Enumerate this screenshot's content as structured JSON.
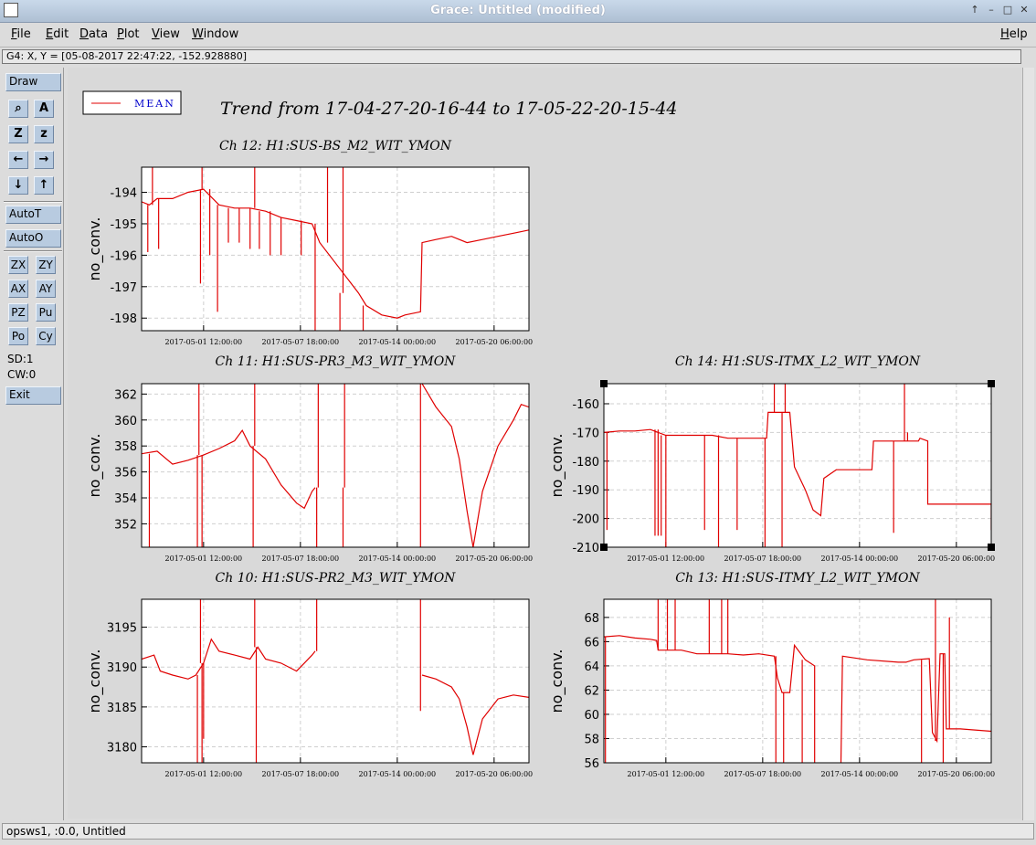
{
  "window": {
    "title": "Grace: Untitled (modified)",
    "buttons": [
      "↑",
      "–",
      "□",
      "✕"
    ]
  },
  "menubar": {
    "items": [
      "File",
      "Edit",
      "Data",
      "Plot",
      "View",
      "Window"
    ],
    "help": "Help"
  },
  "locator": {
    "text": "G4: X, Y = [05-08-2017 22:47:22, -152.928880]"
  },
  "toolpanel": {
    "draw": "Draw",
    "icons": [
      "magnifier-icon",
      "text-icon",
      "zoom-z-big-icon",
      "zoom-z-small-icon",
      "arrow-left-icon",
      "arrow-right-icon",
      "arrow-down-icon",
      "arrow-up-icon"
    ],
    "icon_glyphs": [
      "⌕",
      "A",
      "Z",
      "z",
      "←",
      "→",
      "↓",
      "↑"
    ],
    "autot": "AutoT",
    "autoo": "AutoO",
    "small_buttons": [
      "ZX",
      "ZY",
      "AX",
      "AY",
      "PZ",
      "Pu",
      "Po",
      "Cy"
    ],
    "sd": "SD:1",
    "cw": "CW:0",
    "exit": "Exit"
  },
  "status": {
    "text": "opsws1, :0.0, Untitled"
  },
  "legend": {
    "label": "MEAN",
    "color": "#0000cc",
    "line_color": "#e00000"
  },
  "main_title": "Trend from 17-04-27-20-16-44 to 17-05-22-20-15-44",
  "series_color": "#e00000",
  "chart_data": [
    {
      "type": "line",
      "title": "Ch 12: H1:SUS-BS_M2_WIT_YMON",
      "ylabel": "no_conv.",
      "x_ticks": [
        "2017-05-01 12:00:00",
        "2017-05-07 18:00:00",
        "2017-05-14 00:00:00",
        "2017-05-20 06:00:00"
      ],
      "y_ticks": [
        -194,
        -195,
        -196,
        -197,
        -198
      ],
      "ylim": [
        -198.4,
        -193.2
      ],
      "xlim": [
        0,
        25
      ],
      "trend": [
        [
          0,
          -194.3
        ],
        [
          0.5,
          -194.4
        ],
        [
          1,
          -194.2
        ],
        [
          2,
          -194.2
        ],
        [
          3,
          -194.0
        ],
        [
          4,
          -193.9
        ],
        [
          5,
          -194.4
        ],
        [
          6,
          -194.5
        ],
        [
          7,
          -194.5
        ],
        [
          8,
          -194.6
        ],
        [
          9,
          -194.8
        ],
        [
          10,
          -194.9
        ],
        [
          11,
          -195.0
        ],
        [
          11.5,
          -195.6
        ],
        [
          14,
          -197.2
        ],
        [
          14.5,
          -197.6
        ],
        [
          15.5,
          -197.9
        ],
        [
          16.5,
          -198.0
        ],
        [
          17,
          -197.9
        ],
        [
          18,
          -197.8
        ],
        [
          18.1,
          -195.6
        ],
        [
          19,
          -195.5
        ],
        [
          20,
          -195.4
        ],
        [
          21,
          -195.6
        ],
        [
          22,
          -195.5
        ],
        [
          23,
          -195.4
        ],
        [
          24,
          -195.3
        ],
        [
          25,
          -195.2
        ]
      ],
      "spikes": [
        [
          0.4,
          -195.9
        ],
        [
          0.7,
          -193.1
        ],
        [
          1.1,
          -195.8
        ],
        [
          3.8,
          -196.9
        ],
        [
          3.9,
          -193.1
        ],
        [
          4.4,
          -196.0
        ],
        [
          4.9,
          -197.8
        ],
        [
          5.6,
          -195.6
        ],
        [
          6.3,
          -195.6
        ],
        [
          7.0,
          -195.8
        ],
        [
          7.3,
          -193.1
        ],
        [
          7.6,
          -195.8
        ],
        [
          8.3,
          -196.0
        ],
        [
          9.0,
          -196.0
        ],
        [
          10.3,
          -196.0
        ],
        [
          11.2,
          -198.4
        ],
        [
          12.0,
          -193.1
        ],
        [
          12.8,
          -198.4
        ],
        [
          13.0,
          -193.1
        ],
        [
          14.3,
          -198.4
        ]
      ]
    },
    {
      "type": "line",
      "title": "Ch 11: H1:SUS-PR3_M3_WIT_YMON",
      "ylabel": "no_conv.",
      "x_ticks": [
        "2017-05-01 12:00:00",
        "2017-05-07 18:00:00",
        "2017-05-14 00:00:00",
        "2017-05-20 06:00:00"
      ],
      "y_ticks": [
        362,
        360,
        358,
        356,
        354,
        352
      ],
      "ylim": [
        350.2,
        362.8
      ],
      "xlim": [
        0,
        25
      ],
      "trend": [
        [
          0,
          357.4
        ],
        [
          1,
          357.6
        ],
        [
          2,
          356.6
        ],
        [
          3,
          356.9
        ],
        [
          4,
          357.3
        ],
        [
          5,
          357.8
        ],
        [
          6,
          358.4
        ],
        [
          6.5,
          359.2
        ],
        [
          7,
          358.0
        ],
        [
          8,
          357.0
        ],
        [
          9,
          355.0
        ],
        [
          10,
          353.6
        ],
        [
          10.5,
          353.2
        ],
        [
          11,
          354.5
        ],
        [
          11.2,
          354.8
        ]
      ],
      "trend2": [
        [
          18.1,
          362.8
        ],
        [
          19,
          361.0
        ],
        [
          20,
          359.5
        ],
        [
          20.5,
          357.0
        ],
        [
          21,
          353.0
        ],
        [
          21.4,
          350.2
        ]
      ],
      "trend3": [
        [
          21.4,
          350.2
        ],
        [
          22,
          354.5
        ],
        [
          23,
          358.0
        ],
        [
          24,
          360.0
        ],
        [
          24.5,
          361.2
        ],
        [
          25,
          361.0
        ]
      ],
      "spikes": [
        [
          0.5,
          350.2
        ],
        [
          3.6,
          350.2
        ],
        [
          3.7,
          362.8
        ],
        [
          3.9,
          350.2
        ],
        [
          7.2,
          350.2
        ],
        [
          7.3,
          362.8
        ],
        [
          11.3,
          350.2
        ],
        [
          11.4,
          362.8
        ],
        [
          13.0,
          350.2
        ],
        [
          13.1,
          362.8
        ],
        [
          18.0,
          350.2
        ]
      ]
    },
    {
      "type": "line",
      "title": "Ch 14: H1:SUS-ITMX_L2_WIT_YMON",
      "ylabel": "no_conv.",
      "x_ticks": [
        "2017-05-01 12:00:00",
        "2017-05-07 18:00:00",
        "2017-05-14 00:00:00",
        "2017-05-20 06:00:00"
      ],
      "y_ticks": [
        -160,
        -170,
        -180,
        -190,
        -200,
        -210
      ],
      "ylim": [
        -210,
        -153
      ],
      "xlim": [
        0,
        25
      ],
      "trend": [
        [
          0,
          -170
        ],
        [
          1,
          -169.5
        ],
        [
          2,
          -169.5
        ],
        [
          3,
          -169
        ],
        [
          4,
          -171
        ],
        [
          6,
          -171
        ],
        [
          7,
          -171
        ],
        [
          8,
          -172
        ],
        [
          10,
          -172
        ],
        [
          10.5,
          -172
        ],
        [
          10.6,
          -163
        ],
        [
          11.5,
          -163
        ],
        [
          12,
          -163
        ],
        [
          12.3,
          -182
        ],
        [
          13,
          -190
        ],
        [
          13.5,
          -197
        ],
        [
          14,
          -199
        ],
        [
          14.2,
          -186
        ],
        [
          15,
          -183
        ],
        [
          17,
          -183
        ],
        [
          17.3,
          -183
        ],
        [
          17.4,
          -173
        ],
        [
          19,
          -173
        ],
        [
          20.3,
          -173
        ],
        [
          20.4,
          -172
        ],
        [
          20.9,
          -173
        ],
        [
          20.9,
          -195
        ],
        [
          23,
          -195
        ],
        [
          25,
          -195
        ],
        [
          25,
          -204
        ]
      ],
      "spikes": [
        [
          0.2,
          -204
        ],
        [
          3.3,
          -206
        ],
        [
          3.5,
          -206
        ],
        [
          3.7,
          -206
        ],
        [
          4.0,
          -210
        ],
        [
          6.5,
          -204
        ],
        [
          7.4,
          -210
        ],
        [
          8.6,
          -204
        ],
        [
          10.4,
          -210
        ],
        [
          11.0,
          -153
        ],
        [
          11.5,
          -210
        ],
        [
          11.7,
          -153
        ],
        [
          18.7,
          -205
        ],
        [
          19.4,
          -153
        ],
        [
          19.6,
          -170
        ]
      ]
    },
    {
      "type": "line",
      "title": "Ch 10: H1:SUS-PR2_M3_WIT_YMON",
      "ylabel": "no_conv.",
      "x_ticks": [
        "2017-05-01 12:00:00",
        "2017-05-07 18:00:00",
        "2017-05-14 00:00:00",
        "2017-05-20 06:00:00"
      ],
      "y_ticks": [
        3195,
        3190,
        3185,
        3180
      ],
      "ylim": [
        3178,
        3198.5
      ],
      "xlim": [
        0,
        25
      ],
      "trend": [
        [
          0,
          3191.0
        ],
        [
          0.8,
          3191.5
        ],
        [
          1.2,
          3189.5
        ],
        [
          2,
          3189.0
        ],
        [
          3,
          3188.5
        ],
        [
          3.5,
          3189.0
        ],
        [
          4,
          3190.5
        ],
        [
          4.5,
          3193.5
        ],
        [
          5,
          3192.0
        ],
        [
          6,
          3191.5
        ],
        [
          7,
          3191.0
        ],
        [
          7.5,
          3192.5
        ],
        [
          8,
          3191.0
        ],
        [
          9,
          3190.5
        ],
        [
          10,
          3189.5
        ],
        [
          10.5,
          3190.5
        ],
        [
          11,
          3191.5
        ],
        [
          11.2,
          3192.0
        ]
      ],
      "trend2": [
        [
          18.1,
          3189.0
        ],
        [
          19,
          3188.5
        ],
        [
          20,
          3187.5
        ],
        [
          20.5,
          3186.0
        ],
        [
          21,
          3182.5
        ],
        [
          21.4,
          3179.0
        ],
        [
          22,
          3183.5
        ],
        [
          23,
          3186.0
        ],
        [
          24,
          3186.5
        ],
        [
          25,
          3186.2
        ]
      ],
      "spikes": [
        [
          3.6,
          3178
        ],
        [
          3.8,
          3198.5
        ],
        [
          3.9,
          3178
        ],
        [
          4.0,
          3181
        ],
        [
          7.3,
          3198.5
        ],
        [
          7.4,
          3178
        ],
        [
          11.3,
          3198.5
        ],
        [
          18.0,
          3198.5
        ],
        [
          18.0,
          3184.5
        ]
      ]
    },
    {
      "type": "line",
      "title": "Ch 13: H1:SUS-ITMY_L2_WIT_YMON",
      "ylabel": "no_conv.",
      "x_ticks": [
        "2017-05-01 12:00:00",
        "2017-05-07 18:00:00",
        "2017-05-14 00:00:00",
        "2017-05-20 06:00:00"
      ],
      "y_ticks": [
        68,
        66,
        64,
        62,
        60,
        58,
        56
      ],
      "ylim": [
        56,
        69.5
      ],
      "xlim": [
        0,
        25
      ],
      "trend": [
        [
          0,
          66.4
        ],
        [
          1,
          66.5
        ],
        [
          2,
          66.3
        ],
        [
          3,
          66.2
        ],
        [
          3.4,
          66.1
        ],
        [
          3.5,
          65.3
        ],
        [
          5,
          65.3
        ],
        [
          6,
          65.0
        ],
        [
          8,
          65.0
        ],
        [
          9,
          64.9
        ],
        [
          10,
          65.0
        ],
        [
          11,
          64.8
        ],
        [
          11.2,
          63.0
        ],
        [
          11.5,
          61.8
        ],
        [
          12,
          61.8
        ],
        [
          12.3,
          65.7
        ],
        [
          13,
          64.5
        ],
        [
          13.6,
          64.0
        ],
        [
          13.6,
          56.0
        ]
      ],
      "trend2": [
        [
          15.3,
          56.0
        ],
        [
          15.4,
          64.8
        ],
        [
          17,
          64.5
        ],
        [
          19,
          64.3
        ],
        [
          19.5,
          64.3
        ],
        [
          20,
          64.5
        ],
        [
          21,
          64.6
        ],
        [
          21.2,
          58.5
        ],
        [
          21.5,
          57.8
        ],
        [
          21.7,
          65.0
        ],
        [
          22,
          65.0
        ],
        [
          22.1,
          58.8
        ],
        [
          23,
          58.8
        ],
        [
          25,
          58.6
        ]
      ],
      "spikes": [
        [
          0.1,
          56
        ],
        [
          3.5,
          69.5
        ],
        [
          4.1,
          69.5
        ],
        [
          4.6,
          69.5
        ],
        [
          6.8,
          69.5
        ],
        [
          7.6,
          69.5
        ],
        [
          8.0,
          69.5
        ],
        [
          11.1,
          56
        ],
        [
          11.6,
          56
        ],
        [
          12.8,
          56
        ],
        [
          20.5,
          56
        ],
        [
          21.4,
          69.5
        ],
        [
          21.9,
          56
        ],
        [
          22.3,
          68.0
        ]
      ]
    }
  ]
}
